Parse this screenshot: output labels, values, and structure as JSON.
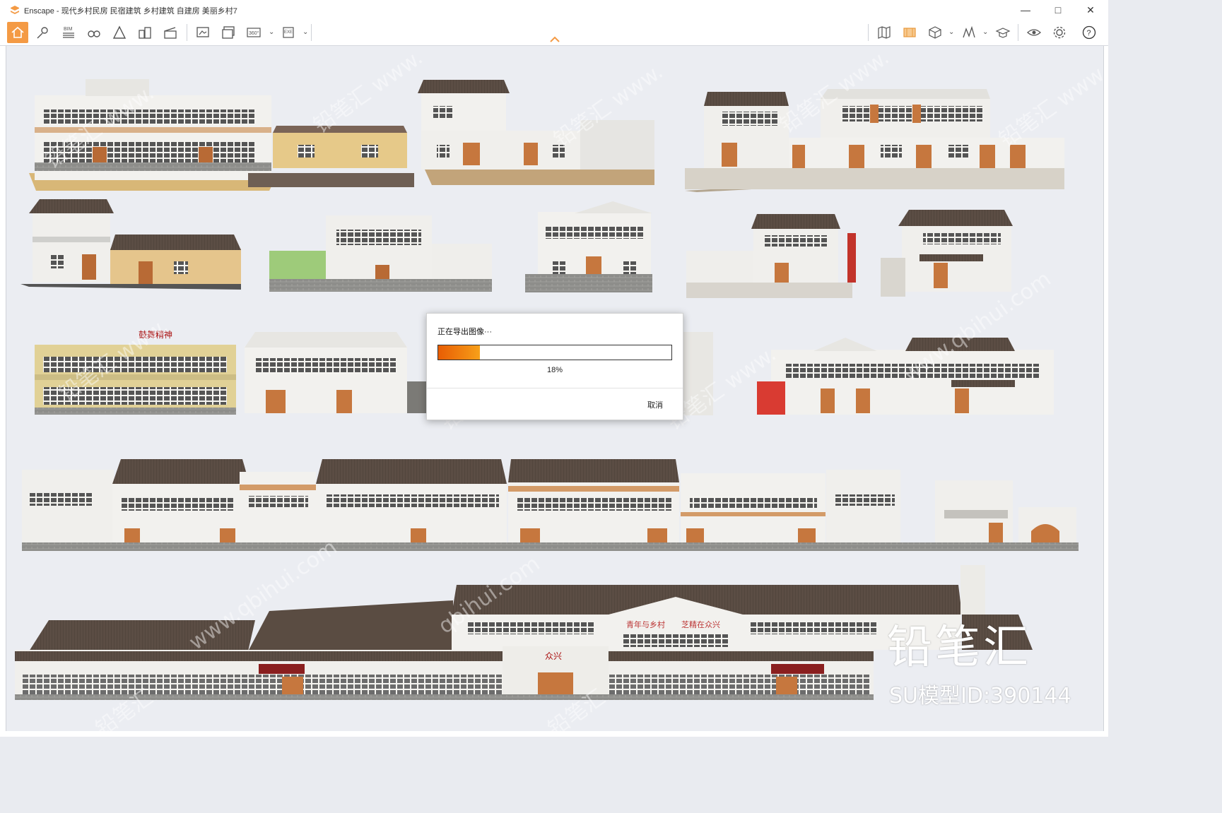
{
  "window": {
    "app_name": "Enscape",
    "title": "Enscape - 现代乡村民房 民宿建筑 乡村建筑 自建房 美丽乡村7",
    "brand_color": "#f49a44"
  },
  "toolbar": {
    "left_icons": [
      "home-icon",
      "location-icon",
      "bim-icon",
      "binoculars-icon",
      "perspective-icon",
      "buildings-icon",
      "clapperboard-icon",
      "screenshot-icon",
      "batch-render-icon",
      "panorama-360-icon",
      "exe-export-icon"
    ],
    "right_icons": [
      "map-icon",
      "asset-library-icon",
      "cube-icon",
      "chart-icon",
      "graduation-cap-icon",
      "eye-icon",
      "settings-icon",
      "help-icon"
    ],
    "bim_label": "BIM",
    "pano_label": "360°",
    "exe_label": "EXE"
  },
  "dialog": {
    "title": "正在导出图像···",
    "progress": 18,
    "progress_text": "18%",
    "cancel_label": "取消"
  },
  "scene": {
    "signs": [
      "鼓舞精神",
      "众兴",
      "青年与乡村",
      "芝精在众兴"
    ]
  },
  "overlay": {
    "brand": "铅笔汇",
    "model_id": "SU模型ID:390144"
  }
}
